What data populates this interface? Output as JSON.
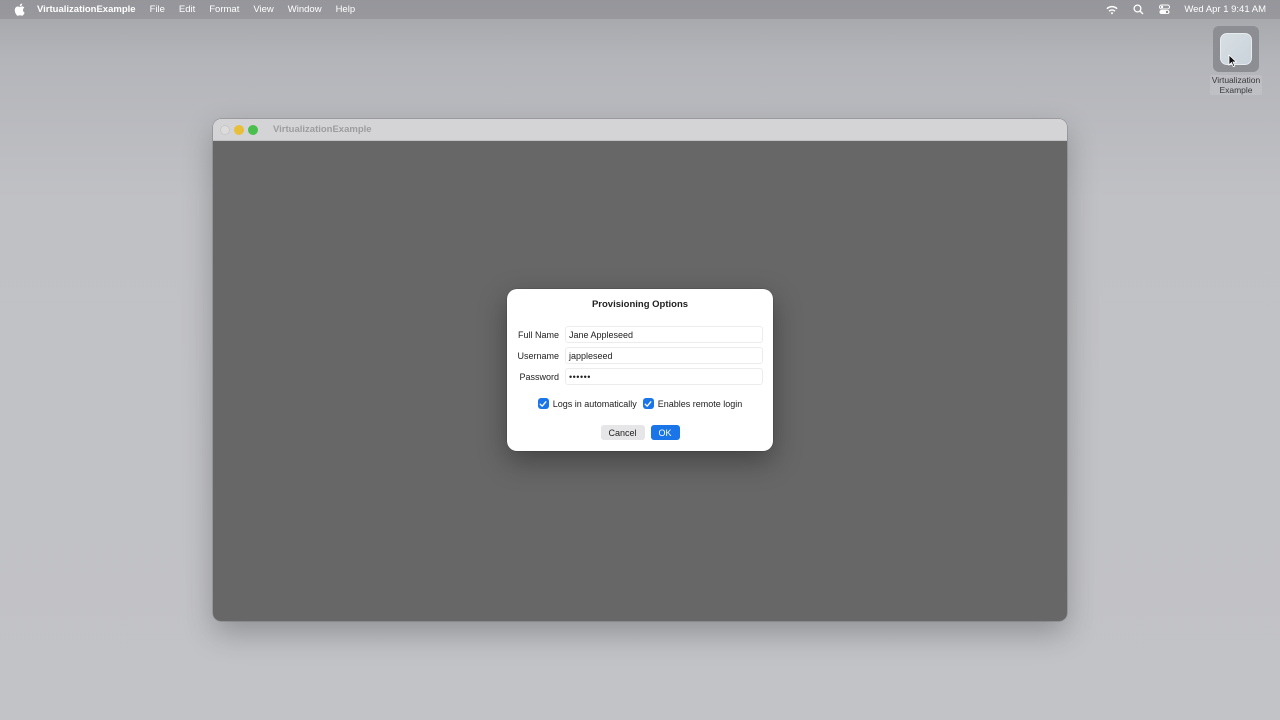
{
  "menubar": {
    "app_name": "VirtualizationExample",
    "items": [
      "File",
      "Edit",
      "Format",
      "View",
      "Window",
      "Help"
    ],
    "clock": "Wed Apr 1  9:41 AM"
  },
  "desktop_icon": {
    "label_line1": "Virtualization",
    "label_line2": "Example"
  },
  "window": {
    "title": "VirtualizationExample"
  },
  "dialog": {
    "title": "Provisioning Options",
    "full_name_label": "Full Name",
    "full_name_value": "Jane Appleseed",
    "username_label": "Username",
    "username_value": "jappleseed",
    "password_label": "Password",
    "password_value": "••••••",
    "auto_login_label": "Logs in automatically",
    "remote_login_label": "Enables remote login",
    "cancel_label": "Cancel",
    "ok_label": "OK"
  },
  "colors": {
    "accent": "#1a76e8",
    "window_content": "#676767"
  }
}
